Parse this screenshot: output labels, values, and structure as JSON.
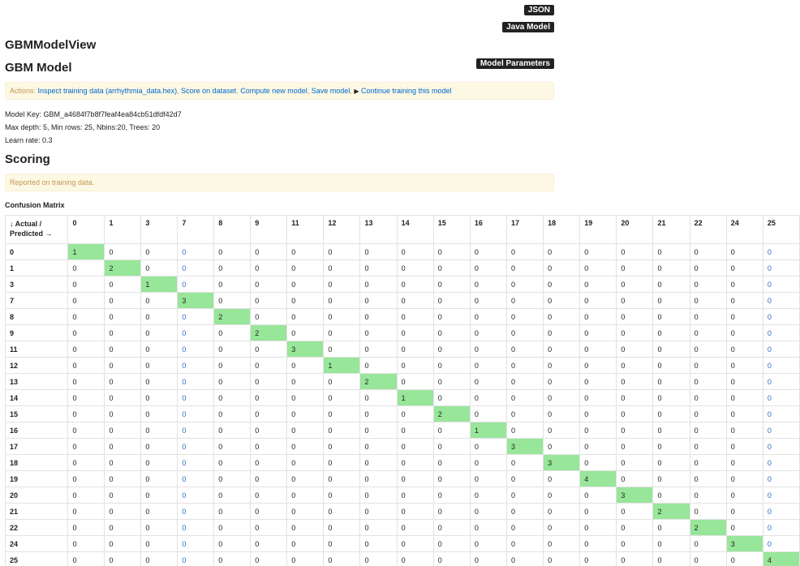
{
  "toolbar": {
    "json_label": "JSON",
    "java_label": "Java Model",
    "params_label": "Model Parameters"
  },
  "view_title": "GBMModelView",
  "model_heading": "GBM Model",
  "actions": {
    "prefix": "Actions:",
    "links": [
      "Inspect training data (arrhythmia_data.hex)",
      "Score on dataset",
      "Compute new model",
      "Save model"
    ],
    "play_icon": "play-icon",
    "continue_label": "Continue training this model"
  },
  "info": {
    "model_key": "Model Key: GBM_a4684f7b8f7feaf4ea84cb51dfdf42d7",
    "params_line": "Max depth: 5, Min rows: 25, Nbins:20, Trees: 20",
    "learn_rate": "Learn rate: 0.3"
  },
  "scoring_heading": "Scoring",
  "reported_note": "Reported on training data.",
  "confusion_matrix": {
    "title": "Confusion Matrix",
    "corner_line1": "↓ Actual /",
    "corner_line2": "Predicted →",
    "classes": [
      "0",
      "1",
      "3",
      "7",
      "8",
      "9",
      "11",
      "12",
      "13",
      "14",
      "15",
      "16",
      "17",
      "18",
      "19",
      "20",
      "21",
      "22",
      "24",
      "25"
    ],
    "diagonal_counts": [
      1,
      2,
      1,
      3,
      2,
      2,
      3,
      1,
      2,
      1,
      2,
      1,
      3,
      3,
      4,
      3,
      2,
      2,
      3,
      4
    ],
    "highlight_color": "#98e69a"
  }
}
